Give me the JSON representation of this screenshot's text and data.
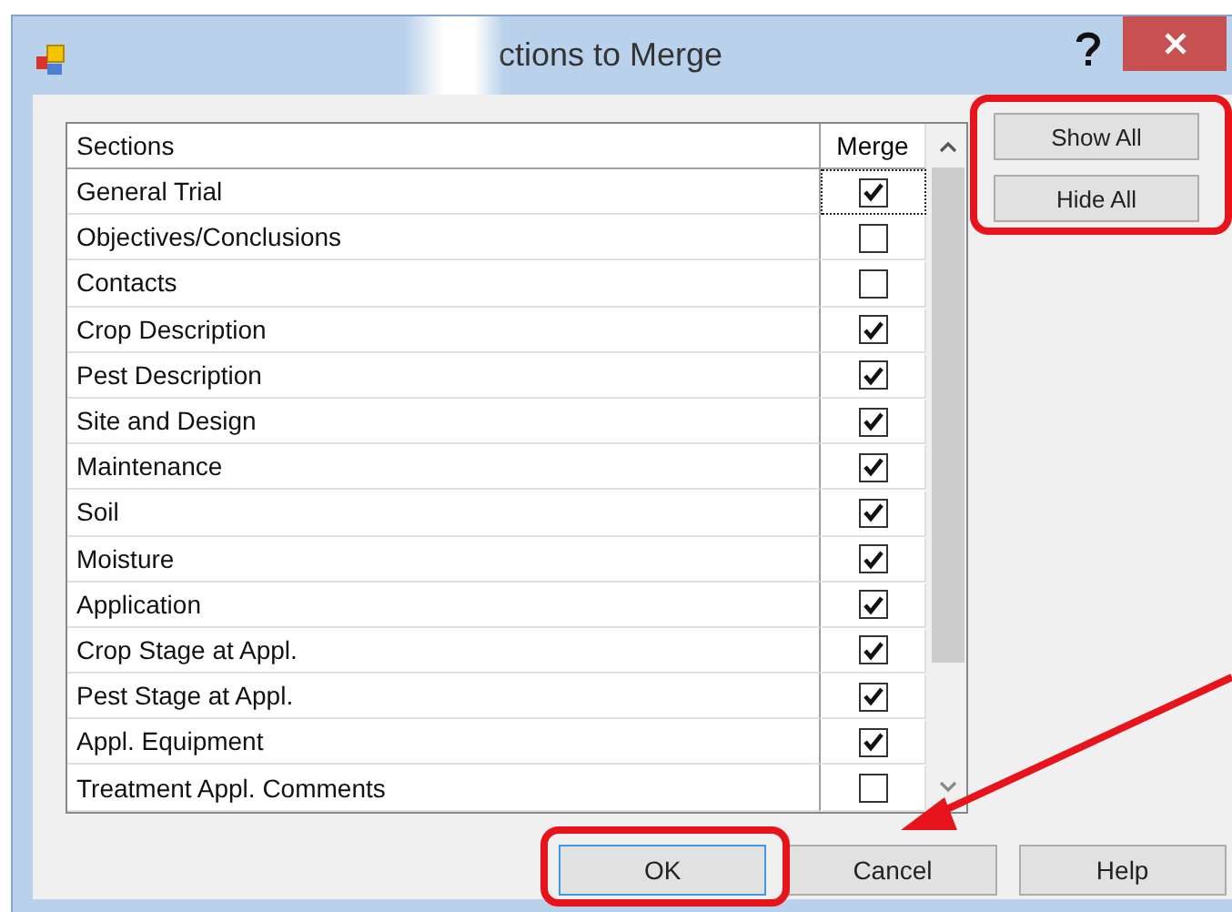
{
  "window": {
    "title": "ctions to Merge"
  },
  "table": {
    "columns": [
      "Sections",
      "Merge"
    ],
    "rows": [
      {
        "section": "General Trial",
        "merge": true,
        "focused": true
      },
      {
        "section": "Objectives/Conclusions",
        "merge": false,
        "focused": false
      },
      {
        "section": "Contacts",
        "merge": false,
        "focused": false
      },
      {
        "section": "Crop Description",
        "merge": true,
        "focused": false
      },
      {
        "section": "Pest Description",
        "merge": true,
        "focused": false
      },
      {
        "section": "Site and Design",
        "merge": true,
        "focused": false
      },
      {
        "section": "Maintenance",
        "merge": true,
        "focused": false
      },
      {
        "section": "Soil",
        "merge": true,
        "focused": false
      },
      {
        "section": "Moisture",
        "merge": true,
        "focused": false
      },
      {
        "section": "Application",
        "merge": true,
        "focused": false
      },
      {
        "section": "Crop Stage at Appl.",
        "merge": true,
        "focused": false
      },
      {
        "section": "Pest Stage at Appl.",
        "merge": true,
        "focused": false
      },
      {
        "section": "Appl. Equipment",
        "merge": true,
        "focused": false
      },
      {
        "section": "Treatment Appl. Comments",
        "merge": false,
        "focused": false
      }
    ]
  },
  "side_buttons": [
    "Show All",
    "Hide All"
  ],
  "buttons": [
    {
      "label": "OK",
      "default": true
    },
    {
      "label": "Cancel",
      "default": false
    },
    {
      "label": "Help",
      "default": false
    }
  ]
}
